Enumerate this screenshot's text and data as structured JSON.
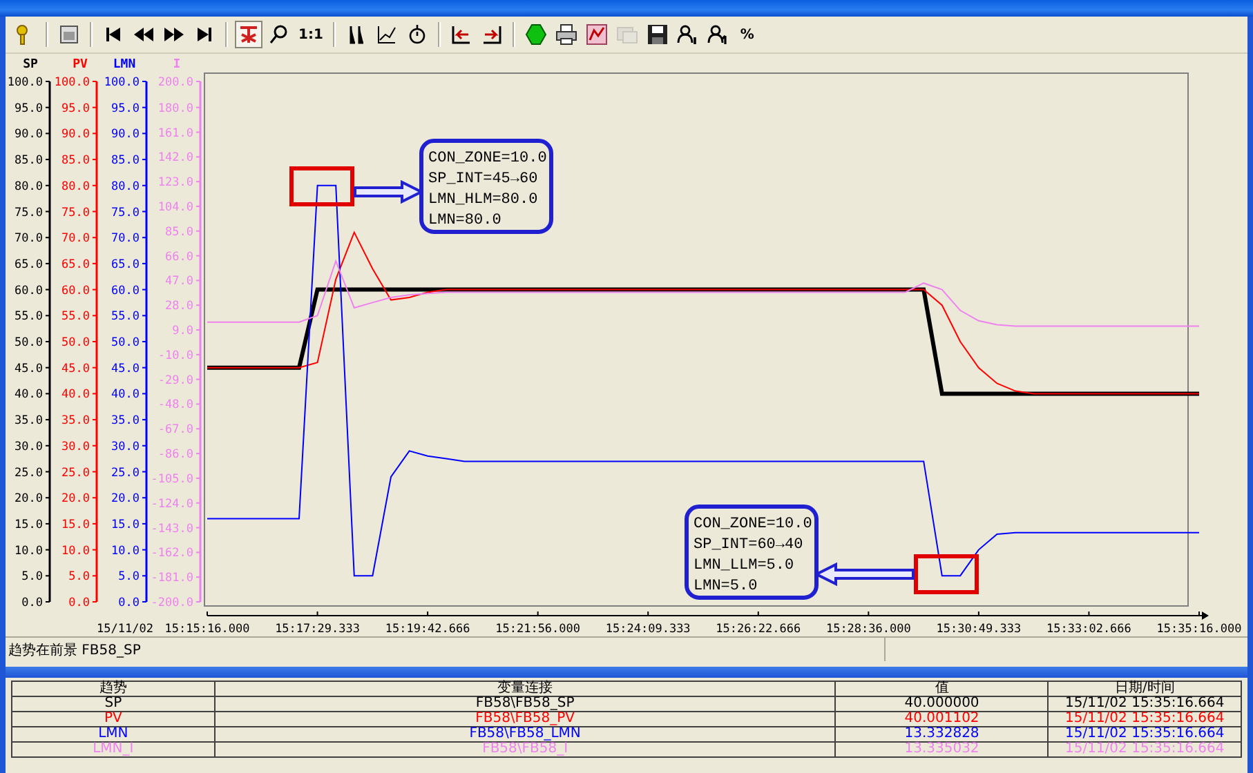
{
  "toolbar": [
    [
      {
        "kind": "icon",
        "selected": false,
        "disabled": false
      }
    ],
    [
      {
        "kind": "icon",
        "selected": false,
        "disabled": false
      }
    ],
    [
      {
        "kind": "icon",
        "selected": false,
        "disabled": false
      },
      {
        "kind": "icon",
        "selected": false,
        "disabled": false
      },
      {
        "kind": "icon",
        "selected": false,
        "disabled": false
      },
      {
        "kind": "icon",
        "selected": false,
        "disabled": false
      }
    ],
    [
      {
        "kind": "icon",
        "selected": true,
        "disabled": false
      },
      {
        "kind": "icon",
        "selected": false,
        "disabled": false
      },
      {
        "kind": "text",
        "label": "1:1",
        "selected": false,
        "disabled": false
      }
    ],
    [
      {
        "kind": "icon",
        "selected": false,
        "disabled": false
      },
      {
        "kind": "icon",
        "selected": false,
        "disabled": false
      },
      {
        "kind": "icon",
        "selected": false,
        "disabled": false
      }
    ],
    [
      {
        "kind": "icon",
        "selected": false,
        "disabled": false
      },
      {
        "kind": "icon",
        "selected": false,
        "disabled": false
      }
    ],
    [
      {
        "kind": "icon",
        "selected": false,
        "disabled": false
      },
      {
        "kind": "icon",
        "selected": false,
        "disabled": false
      },
      {
        "kind": "icon",
        "selected": false,
        "disabled": false
      },
      {
        "kind": "icon",
        "selected": false,
        "disabled": true
      },
      {
        "kind": "icon",
        "selected": false,
        "disabled": false
      },
      {
        "kind": "icon",
        "selected": false,
        "disabled": false
      },
      {
        "kind": "icon",
        "selected": false,
        "disabled": false
      },
      {
        "kind": "text",
        "label": "%",
        "selected": false,
        "disabled": false
      }
    ]
  ],
  "trend": {
    "date": "15/11/02",
    "axes": [
      {
        "ticks": [
          "100.0",
          "95.0",
          "90.0",
          "85.0",
          "80.0",
          "75.0",
          "70.0",
          "65.0",
          "60.0",
          "55.0",
          "50.0",
          "45.0",
          "40.0",
          "35.0",
          "30.0",
          "25.0",
          "20.0",
          "15.0",
          "10.0",
          "5.0",
          "0.0"
        ]
      },
      {
        "ticks": [
          "100.0",
          "95.0",
          "90.0",
          "85.0",
          "80.0",
          "75.0",
          "70.0",
          "65.0",
          "60.0",
          "55.0",
          "50.0",
          "45.0",
          "40.0",
          "35.0",
          "30.0",
          "25.0",
          "20.0",
          "15.0",
          "10.0",
          "5.0",
          "0.0"
        ]
      }
    ],
    "chart_data": {
      "type": "line",
      "ylim": [
        0,
        100
      ],
      "yticks": [
        {
          "value": 100,
          "label": "100.0"
        },
        {
          "value": 95,
          "label": "95.0"
        },
        {
          "value": 90,
          "label": "90.0"
        },
        {
          "value": 85,
          "label": "85.0"
        },
        {
          "value": 80,
          "label": "80.0"
        },
        {
          "value": 75,
          "label": "75.0"
        },
        {
          "value": 70,
          "label": "70.0"
        },
        {
          "value": 65,
          "label": "65.0"
        },
        {
          "value": 60,
          "label": "60.0"
        },
        {
          "value": 55,
          "label": "55.0"
        },
        {
          "value": 50,
          "label": "50.0"
        },
        {
          "value": 45,
          "label": "45.0"
        },
        {
          "value": 40,
          "label": "40.0"
        },
        {
          "value": 35,
          "label": "35.0"
        },
        {
          "value": 30,
          "label": "30.0"
        },
        {
          "value": 25,
          "label": "25.0"
        },
        {
          "value": 20,
          "label": "20.0"
        },
        {
          "value": 15,
          "label": "15.0"
        },
        {
          "value": 10,
          "label": "10.0"
        },
        {
          "value": 5,
          "label": "5.0"
        },
        {
          "value": 0,
          "label": "0.0"
        }
      ],
      "y2lim": [
        -200,
        200
      ],
      "y2ticks": [
        {
          "value": 200,
          "label": "200.0"
        },
        {
          "value": 180,
          "label": "180.0"
        },
        {
          "value": 161,
          "label": "161.0"
        },
        {
          "value": 142,
          "label": "142.0"
        },
        {
          "value": 123,
          "label": "123.0"
        },
        {
          "value": 104,
          "label": "104.0"
        },
        {
          "value": 85,
          "label": "85.0"
        },
        {
          "value": 66,
          "label": "66.0"
        },
        {
          "value": 47,
          "label": "47.0"
        },
        {
          "value": 28,
          "label": "28.0"
        },
        {
          "value": 9,
          "label": "9.0"
        },
        {
          "value": -10,
          "label": "-10.0"
        },
        {
          "value": -29,
          "label": "-29.0"
        },
        {
          "value": -48,
          "label": "-48.0"
        },
        {
          "value": -67,
          "label": "-67.0"
        },
        {
          "value": -86,
          "label": "-86.0"
        },
        {
          "value": -105,
          "label": "-105.0"
        },
        {
          "value": -124,
          "label": "-124.0"
        },
        {
          "value": -143,
          "label": "-143.0"
        },
        {
          "value": -162,
          "label": "-162.0"
        },
        {
          "value": -181,
          "label": "-181.0"
        },
        {
          "value": -200,
          "label": "-200.0"
        }
      ],
      "categories": [
        "15:15:16.000",
        null,
        null,
        null,
        null,
        null,
        "15:17:29.333",
        null,
        null,
        null,
        null,
        null,
        "15:19:42.666",
        null,
        null,
        null,
        null,
        null,
        "15:21:56.000",
        null,
        null,
        null,
        null,
        null,
        "15:24:09.333",
        null,
        null,
        null,
        null,
        null,
        "15:26:22.666",
        null,
        null,
        null,
        null,
        null,
        "15:28:36.000",
        null,
        null,
        null,
        null,
        null,
        "15:30:49.333",
        null,
        null,
        null,
        null,
        null,
        "15:33:02.666",
        null,
        null,
        null,
        null,
        null,
        "15:35:16.000"
      ],
      "series": [
        {
          "name": "SP",
          "color": "#000000",
          "values": [
            45,
            45,
            45,
            45,
            45,
            45,
            60,
            60,
            60,
            60,
            60,
            60,
            60,
            60,
            60,
            60,
            60,
            60,
            60,
            60,
            60,
            60,
            60,
            60,
            60,
            60,
            60,
            60,
            60,
            60,
            60,
            60,
            60,
            60,
            60,
            60,
            60,
            60,
            60,
            60,
            40,
            40,
            40,
            40,
            40,
            40,
            40,
            40,
            40,
            40,
            40,
            40,
            40,
            40,
            40
          ]
        },
        {
          "name": "PV",
          "color": "#ff0000",
          "values": [
            45,
            45,
            45,
            45,
            45,
            45,
            46,
            62,
            71,
            64,
            58,
            58.5,
            59.5,
            60,
            60,
            60,
            60,
            60,
            60,
            60,
            60,
            60,
            60,
            60,
            60,
            60,
            60,
            60,
            60,
            60,
            60,
            60,
            60,
            60,
            60,
            60,
            60,
            60,
            60,
            60,
            57,
            50,
            45,
            42,
            40.5,
            40,
            40,
            40,
            40,
            40,
            40,
            40,
            40,
            40,
            40
          ]
        },
        {
          "name": "LMN",
          "color": "#0000ff",
          "values": [
            16,
            16,
            16,
            16,
            16,
            16,
            80,
            80,
            5,
            5,
            24,
            29,
            28,
            27.5,
            27,
            27,
            27,
            27,
            27,
            27,
            27,
            27,
            27,
            27,
            27,
            27,
            27,
            27,
            27,
            27,
            27,
            27,
            27,
            27,
            27,
            27,
            27,
            27,
            27,
            27,
            5,
            5,
            10,
            13,
            13.3,
            13.3,
            13.3,
            13.3,
            13.3,
            13.3,
            13.3,
            13.3,
            13.3,
            13.3,
            13.3
          ]
        },
        {
          "name": "I",
          "color": "#ee82ee",
          "axis": "y2",
          "values": [
            15,
            15,
            15,
            15,
            15,
            15,
            20,
            62,
            26,
            30,
            34,
            36,
            37,
            38,
            38,
            38,
            38,
            38,
            38,
            38,
            38,
            38,
            38,
            38,
            38,
            38,
            38,
            38,
            38,
            38,
            38,
            38,
            38,
            38,
            38,
            38,
            38,
            38,
            38,
            45,
            40,
            24,
            16,
            13,
            12,
            12,
            12,
            12,
            12,
            12,
            12,
            12,
            12,
            12,
            12
          ]
        }
      ],
      "annotations": [
        "CON_ZONE=10.0\nSP_INT=45→60\nLMN_HLM=80.0\nLMN=80.0",
        "CON_ZONE=10.0\nSP_INT=60→40\nLMN_LLM=5.0\nLMN=5.0"
      ]
    }
  },
  "status_bar": "趋势在前景 FB58_SP",
  "table": {
    "columns": [
      "趋势",
      "变量连接",
      "值",
      "日期/时间"
    ],
    "rows": [
      {
        "color": "#000000",
        "cells": [
          "SP",
          "FB58\\FB58_SP",
          "40.000000",
          "15/11/02 15:35:16.664"
        ]
      },
      {
        "color": "#ff0000",
        "cells": [
          "PV",
          "FB58\\FB58_PV",
          "40.001102",
          "15/11/02 15:35:16.664"
        ]
      },
      {
        "color": "#0000ff",
        "cells": [
          "LMN",
          "FB58\\FB58_LMN",
          "13.332828",
          "15/11/02 15:35:16.664"
        ]
      },
      {
        "color": "#ee82ee",
        "cells": [
          "LMN_I",
          "FB58\\FB58_I",
          "13.335032",
          "15/11/02 15:35:16.664"
        ]
      }
    ]
  }
}
